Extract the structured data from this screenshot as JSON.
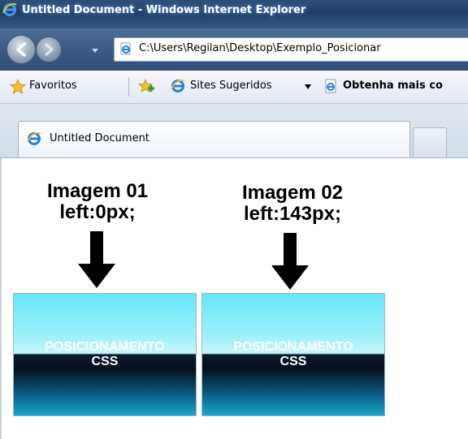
{
  "window": {
    "title": "Untitled Document - Windows Internet Explorer"
  },
  "nav": {
    "address": "C:\\Users\\Regilan\\Desktop\\Exemplo_Posicionar"
  },
  "favorites": {
    "favoritos_label": "Favoritos",
    "sites_label": "Sites Sugeridos",
    "obtenha_label": "Obtenha mais co"
  },
  "tabs": [
    {
      "label": "Untitled Document"
    }
  ],
  "content": {
    "images": [
      {
        "caption_line1": "Imagem 01",
        "caption_line2": "left:0px;",
        "banner_line1": "POSICIONAMENTO",
        "banner_line2": "CSS"
      },
      {
        "caption_line1": "Imagem 02",
        "caption_line2": "left:143px;",
        "banner_line1": "POSICIONAMENTO",
        "banner_line2": "CSS"
      }
    ]
  },
  "icons": {
    "browser": "ie-icon",
    "back": "back-arrow-icon",
    "forward": "forward-arrow-icon",
    "favorites": "star-icon",
    "add_favorite": "add-favorite-icon",
    "page": "page-icon",
    "arrow": "down-arrow-icon"
  },
  "colors": {
    "titlebar": "#1f3e66",
    "ie_blue": "#2a7fd8",
    "banner_top": "#66e6f8",
    "banner_bottom": "#06101e"
  }
}
